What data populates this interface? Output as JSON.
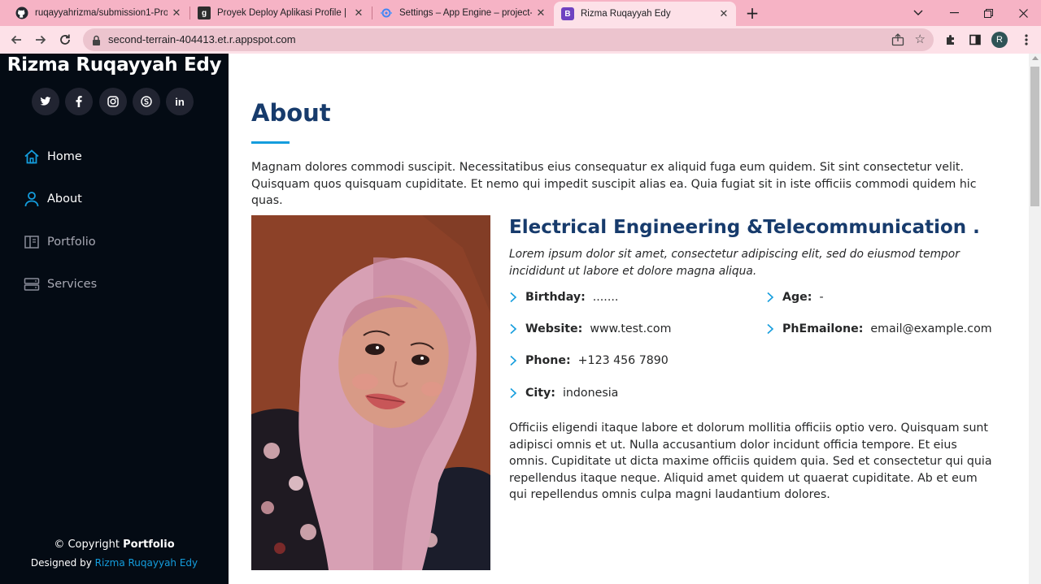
{
  "browser": {
    "tabs": [
      {
        "title": "ruqayyahrizma/submission1-Pro",
        "icon": "github-icon"
      },
      {
        "title": "Proyek Deploy Aplikasi Profile | ",
        "icon": "g-icon"
      },
      {
        "title": "Settings – App Engine – project-",
        "icon": "app-engine-icon"
      },
      {
        "title": "Rizma Ruqayyah Edy",
        "icon": "bootstrap-icon",
        "active": true
      }
    ],
    "url": "second-terrain-404413.et.r.appspot.com",
    "avatar_letter": "R"
  },
  "sidebar": {
    "site_name": "Rizma Ruqayyah Edy",
    "social": [
      "twitter-icon",
      "facebook-icon",
      "instagram-icon",
      "skype-icon",
      "linkedin-icon"
    ],
    "nav": [
      {
        "label": "Home",
        "icon": "home-icon"
      },
      {
        "label": "About",
        "icon": "user-icon"
      },
      {
        "label": "Portfolio",
        "icon": "book-icon"
      },
      {
        "label": "Services",
        "icon": "server-icon"
      }
    ],
    "copyright_prefix": "© Copyright",
    "copyright_name": "Portfolio",
    "credits_prefix": "Designed by",
    "credits_link": "Rizma Ruqayyah Edy"
  },
  "about": {
    "title": "About",
    "intro": "Magnam dolores commodi suscipit. Necessitatibus eius consequatur ex aliquid fuga eum quidem. Sit sint consectetur velit. Quisquam quos quisquam cupiditate. Et nemo qui impedit suscipit alias ea. Quia fugiat sit in iste officiis commodi quidem hic quas.",
    "heading": "Electrical Engineering &Telecommunication .",
    "lead": "Lorem ipsum dolor sit amet, consectetur adipiscing elit, sed do eiusmod tempor incididunt ut labore et dolore magna aliqua.",
    "info": [
      {
        "label": "Birthday:",
        "value": "......."
      },
      {
        "label": "Age:",
        "value": "-"
      },
      {
        "label": "Website:",
        "value": "www.test.com"
      },
      {
        "label": "PhEmailone:",
        "value": "email@example.com"
      },
      {
        "label": "Phone:",
        "value": "+123 456 7890"
      },
      {
        "label": "City:",
        "value": "indonesia"
      }
    ],
    "outro": "Officiis eligendi itaque labore et dolorum mollitia officiis optio vero. Quisquam sunt adipisci omnis et ut. Nulla accusantium dolor incidunt officia tempore. Et eius omnis. Cupiditate ut dicta maxime officiis quidem quia. Sed et consectetur qui quia repellendus itaque neque. Aliquid amet quidem ut quaerat cupiditate. Ab et eum qui repellendus omnis culpa magni laudantium dolores."
  },
  "colors": {
    "sidebar_bg": "#040b14",
    "accent": "#149ddd",
    "heading": "#173b6c",
    "tabstrip": "#f6b3c5",
    "toolbar": "#fde1e8"
  }
}
